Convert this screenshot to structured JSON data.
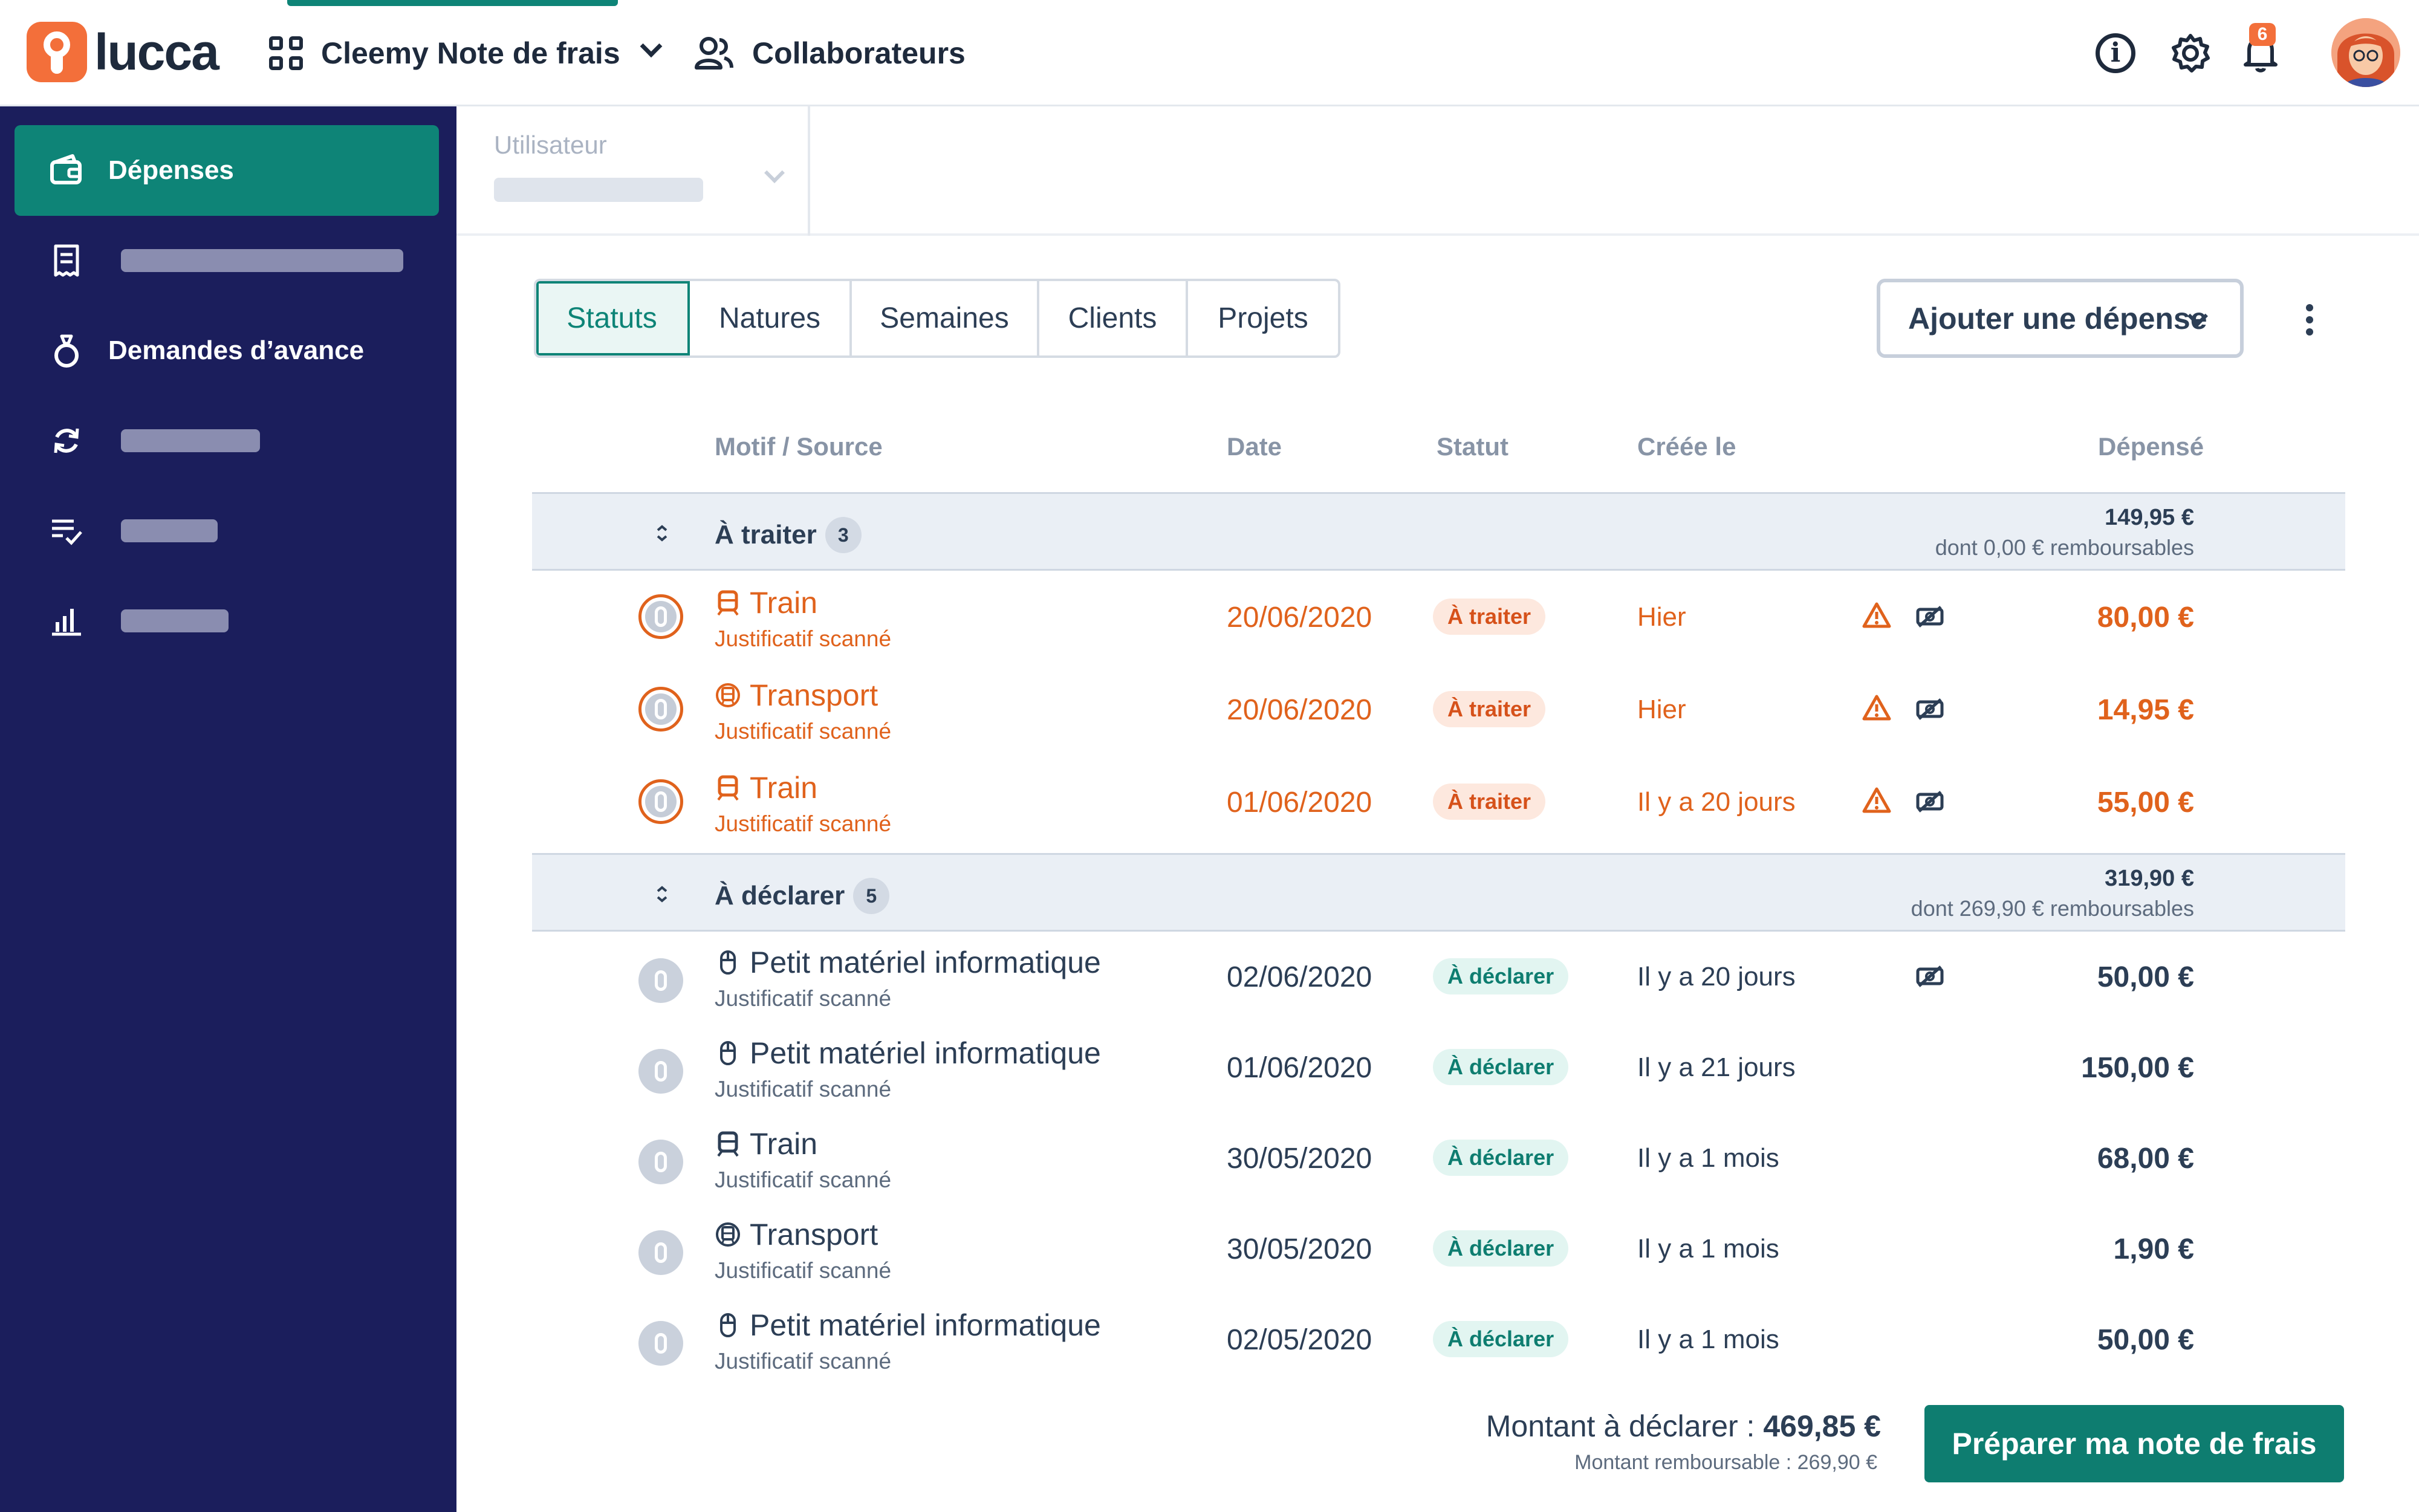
{
  "header": {
    "logo_text": "lucca",
    "app_name": "Cleemy Note de frais",
    "collab_label": "Collaborateurs",
    "notification_count": "6"
  },
  "sidebar": {
    "items": [
      {
        "label": "Dépenses",
        "icon": "wallet-icon"
      },
      {
        "label": "",
        "icon": "receipt-icon"
      },
      {
        "label": "Demandes d’avance",
        "icon": "money-bag-icon"
      },
      {
        "label": "",
        "icon": "sync-icon"
      },
      {
        "label": "",
        "icon": "checklist-icon"
      },
      {
        "label": "",
        "icon": "stats-icon"
      }
    ]
  },
  "filter": {
    "user_label": "Utilisateur"
  },
  "tabs": [
    "Statuts",
    "Natures",
    "Semaines",
    "Clients",
    "Projets"
  ],
  "selected_tab": "Statuts",
  "actions": {
    "add_expense": "Ajouter une dépense"
  },
  "table": {
    "headers": [
      "Motif / Source",
      "Date",
      "Statut",
      "Créée le",
      "Dépensé"
    ],
    "groups": [
      {
        "name": "À traiter",
        "count": "3",
        "total": "149,95 €",
        "sub": "dont 0,00 € remboursables",
        "rows": [
          {
            "motif": "Train",
            "source": "Justificatif scanné",
            "date": "20/06/2020",
            "status": "À traiter",
            "created": "Hier",
            "amount": "80,00 €"
          },
          {
            "motif": "Transport",
            "source": "Justificatif scanné",
            "date": "20/06/2020",
            "status": "À traiter",
            "created": "Hier",
            "amount": "14,95 €"
          },
          {
            "motif": "Train",
            "source": "Justificatif scanné",
            "date": "01/06/2020",
            "status": "À traiter",
            "created": "Il y a 20 jours",
            "amount": "55,00 €"
          }
        ]
      },
      {
        "name": "À déclarer",
        "count": "5",
        "total": "319,90 €",
        "sub": "dont 269,90 € remboursables",
        "rows": [
          {
            "motif": "Petit matériel informatique",
            "source": "Justificatif scanné",
            "date": "02/06/2020",
            "status": "À déclarer",
            "created": "Il y a 20 jours",
            "amount": "50,00 €"
          },
          {
            "motif": "Petit matériel informatique",
            "source": "Justificatif scanné",
            "date": "01/06/2020",
            "status": "À déclarer",
            "created": "Il y a 21 jours",
            "amount": "150,00 €"
          },
          {
            "motif": "Train",
            "source": "Justificatif scanné",
            "date": "30/05/2020",
            "status": "À déclarer",
            "created": "Il y a 1 mois",
            "amount": "68,00 €"
          },
          {
            "motif": "Transport",
            "source": "Justificatif scanné",
            "date": "30/05/2020",
            "status": "À déclarer",
            "created": "Il y a 1 mois",
            "amount": "1,90 €"
          },
          {
            "motif": "Petit matériel informatique",
            "source": "Justificatif scanné",
            "date": "02/05/2020",
            "status": "À déclarer",
            "created": "Il y a 1 mois",
            "amount": "50,00 €"
          }
        ]
      }
    ]
  },
  "footer": {
    "amount_label": "Montant à déclarer :",
    "amount_value": "469,85 €",
    "refundable": "Montant remboursable : 269,90 €",
    "prepare_button": "Préparer ma note de frais"
  },
  "colors": {
    "brand_teal": "#0e8477",
    "sidebar_bg": "#1b1e5c",
    "todo_orange": "#e0621c",
    "logo_orange": "#f36f3a"
  }
}
